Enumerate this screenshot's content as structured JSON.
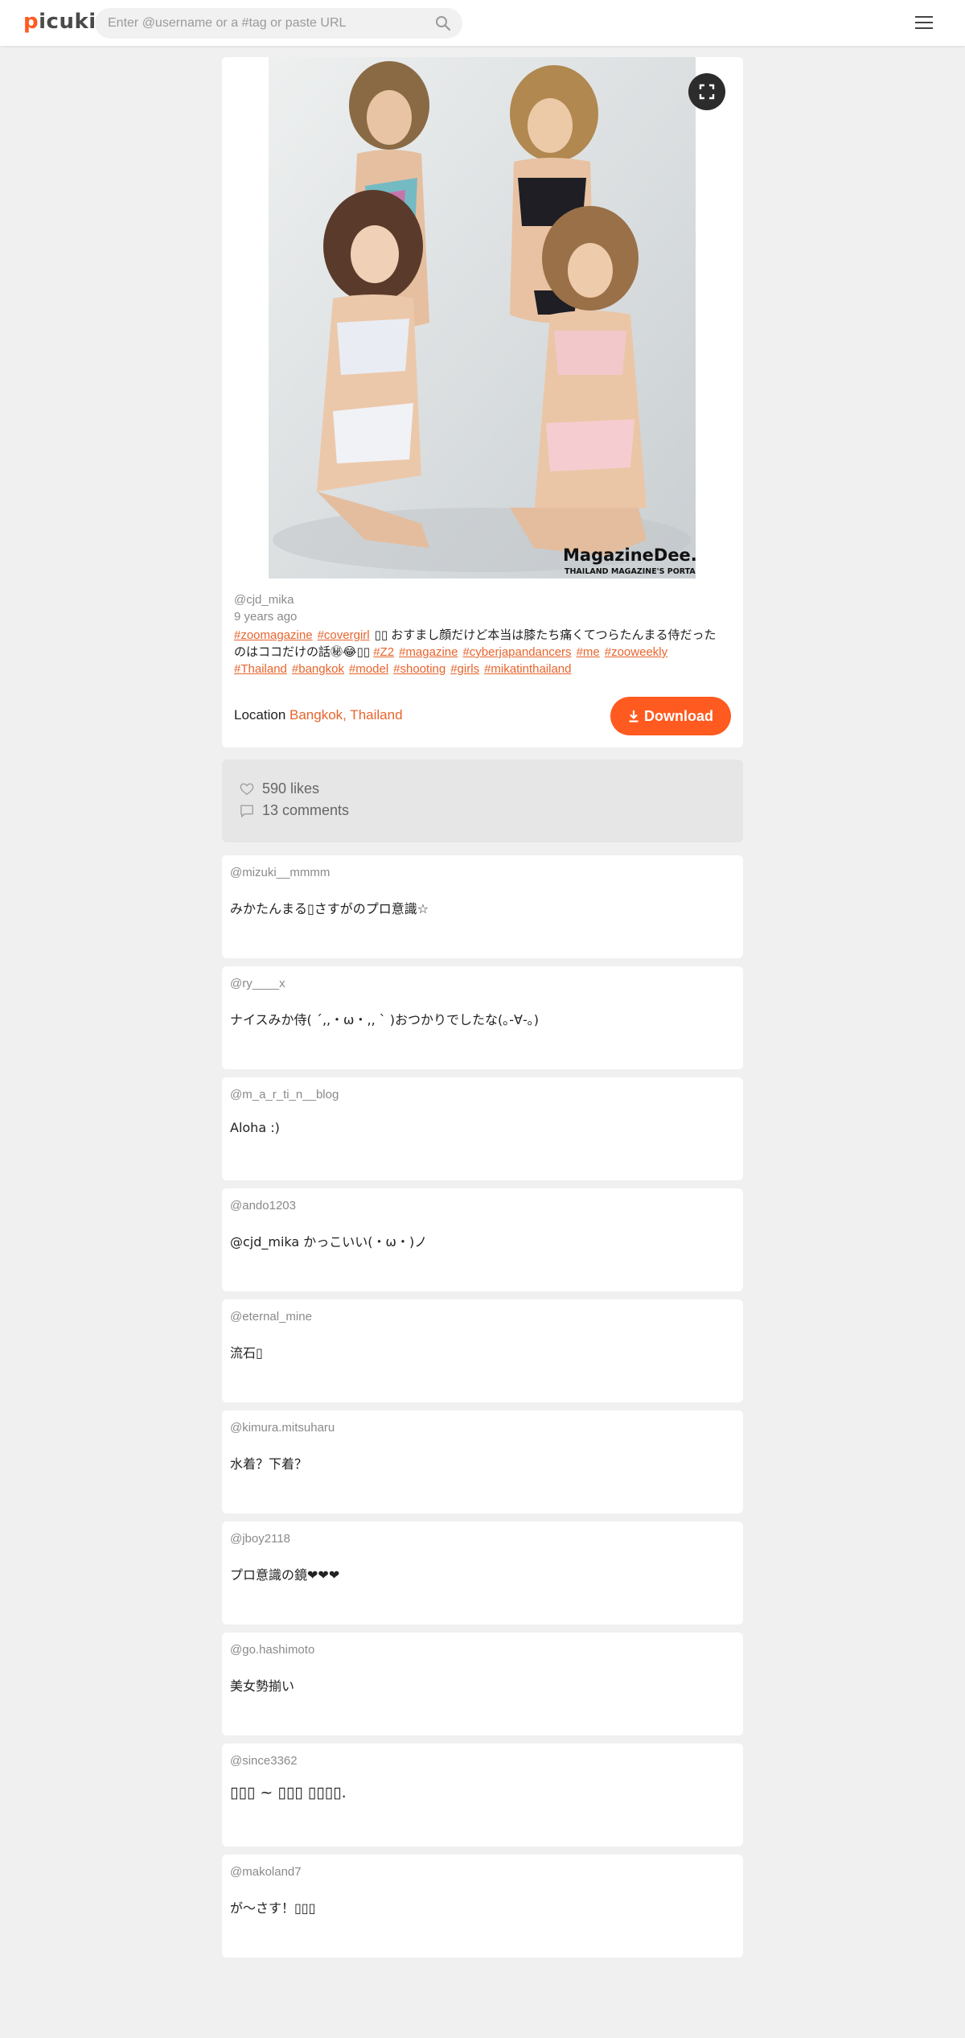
{
  "header": {
    "logo_first": "p",
    "logo_rest": "icuki",
    "search_placeholder": "Enter @username or a #tag or paste URL"
  },
  "post": {
    "author": "@cjd_mika",
    "time_ago": "9 years ago",
    "photo_watermark": "MagazineDee.com",
    "photo_watermark_sub": "THAILAND MAGAZINE'S PORTAL",
    "caption_lines": [
      {
        "tags_before": [
          "#zoomagazine",
          "#covergirl"
        ],
        "text": "▯▯ おすまし顔だけど本当は膝たち痛くてつらたんまる侍だった"
      },
      {
        "text": "のはココだけの話㊙😂▯▯",
        "tags_after": [
          "#Z2",
          "#magazine",
          "#cyberjapandancers",
          "#me",
          "#zooweekly"
        ]
      },
      {
        "tags_after": [
          "#Thailand",
          "#bangkok",
          "#model",
          "#shooting",
          "#girls",
          "#mikatinthailand"
        ]
      }
    ],
    "location_label": "Location",
    "location_value": "Bangkok, Thailand",
    "download_label": "Download"
  },
  "stats": {
    "likes": "590 likes",
    "comments": "13 comments"
  },
  "comments": [
    {
      "user": "@mizuki__mmmm",
      "text": "みかたんまる▯さすがのプロ意識☆"
    },
    {
      "user": "@ry____x",
      "text": "ナイスみか侍( ´‚‚・ω・‚‚ ` )おつかりでしたな(｡-∀-｡)"
    },
    {
      "user": "@m_a_r_ti_n__blog",
      "text": "Aloha :)"
    },
    {
      "user": "@ando1203",
      "text": "@cjd_mika かっこいい(・ω・)ノ"
    },
    {
      "user": "@eternal_mine",
      "text": "流石▯"
    },
    {
      "user": "@kimura.mitsuharu",
      "text": "水着？下着？"
    },
    {
      "user": "@jboy2118",
      "text": "プロ意識の鏡❤❤❤"
    },
    {
      "user": "@go.hashimoto",
      "text": "美女勢揃い"
    },
    {
      "user": "@since3362",
      "text": "▯▯▯ ~ ▯▯▯ ▯▯▯▯."
    },
    {
      "user": "@makoland7",
      "text": "が〜さす！▯▯▯"
    }
  ],
  "colors": {
    "accent": "#ff5a1f",
    "link": "#e8642c",
    "page_bg": "#f0f0f0"
  },
  "icons": {
    "search": "search-icon",
    "menu": "hamburger-menu-icon",
    "expand": "fullscreen-icon",
    "download": "download-icon",
    "likes": "heart-icon",
    "comments": "speech-bubble-icon"
  }
}
